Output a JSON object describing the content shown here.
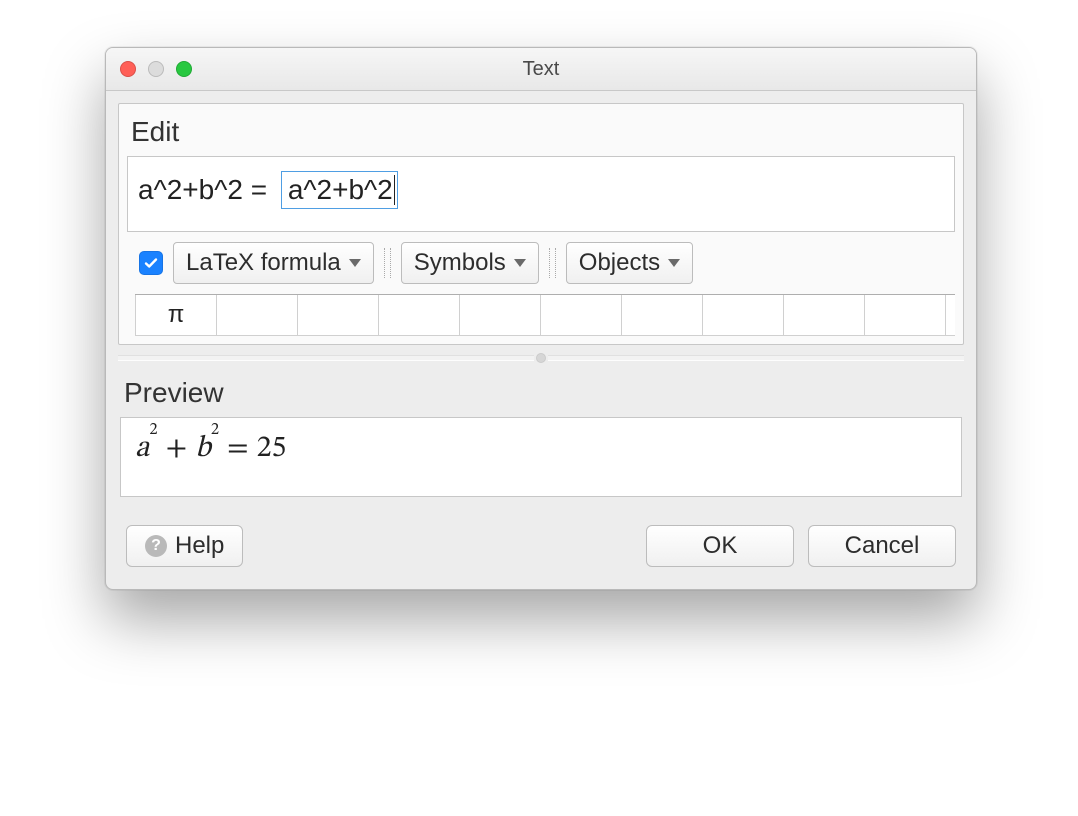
{
  "window": {
    "title": "Text"
  },
  "edit": {
    "label": "Edit",
    "plain_text": "a^2+b^2 = ",
    "field_text": "a^2+b^2"
  },
  "toolbar": {
    "latex_checked": true,
    "latex_label": "LaTeX formula",
    "symbols_label": "Symbols",
    "objects_label": "Objects"
  },
  "tabs": {
    "first_symbol": "π"
  },
  "preview": {
    "label": "Preview",
    "a": "a",
    "b": "b",
    "eq": "=",
    "plus": "+",
    "sup2a": "2",
    "sup2b": "2",
    "result": "25"
  },
  "footer": {
    "help": "Help",
    "ok": "OK",
    "cancel": "Cancel"
  }
}
